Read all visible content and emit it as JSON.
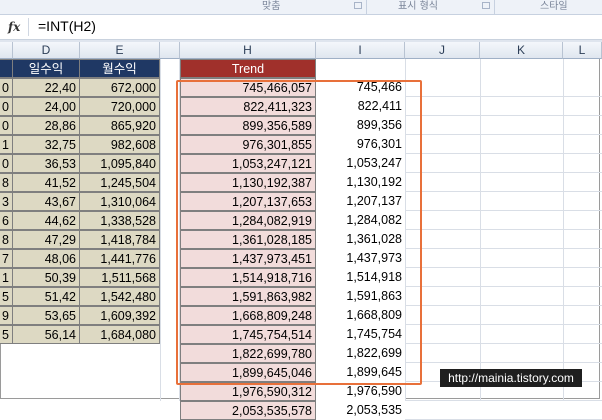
{
  "ribbon": {
    "groups": [
      "맞춤",
      "표시 형식",
      "스타일"
    ]
  },
  "formula_bar": {
    "fx_label": "fx",
    "formula": "=INT(H2)"
  },
  "columns": [
    "",
    "D",
    "E",
    "",
    "H",
    "I",
    "J",
    "K",
    "L"
  ],
  "table": {
    "headers": [
      "",
      "일수익",
      "월수익",
      "Trend"
    ],
    "rows": [
      {
        "c": "0",
        "d": "22,40",
        "e": "672,000",
        "h": "745,466,057",
        "i": "745,466"
      },
      {
        "c": "0",
        "d": "24,00",
        "e": "720,000",
        "h": "822,411,323",
        "i": "822,411"
      },
      {
        "c": "0",
        "d": "28,86",
        "e": "865,920",
        "h": "899,356,589",
        "i": "899,356"
      },
      {
        "c": "1",
        "d": "32,75",
        "e": "982,608",
        "h": "976,301,855",
        "i": "976,301"
      },
      {
        "c": "0",
        "d": "36,53",
        "e": "1,095,840",
        "h": "1,053,247,121",
        "i": "1,053,247"
      },
      {
        "c": "8",
        "d": "41,52",
        "e": "1,245,504",
        "h": "1,130,192,387",
        "i": "1,130,192"
      },
      {
        "c": "3",
        "d": "43,67",
        "e": "1,310,064",
        "h": "1,207,137,653",
        "i": "1,207,137"
      },
      {
        "c": "6",
        "d": "44,62",
        "e": "1,338,528",
        "h": "1,284,082,919",
        "i": "1,284,082"
      },
      {
        "c": "8",
        "d": "47,29",
        "e": "1,418,784",
        "h": "1,361,028,185",
        "i": "1,361,028"
      },
      {
        "c": "7",
        "d": "48,06",
        "e": "1,441,776",
        "h": "1,437,973,451",
        "i": "1,437,973"
      },
      {
        "c": "1",
        "d": "50,39",
        "e": "1,511,568",
        "h": "1,514,918,716",
        "i": "1,514,918"
      },
      {
        "c": "5",
        "d": "51,42",
        "e": "1,542,480",
        "h": "1,591,863,982",
        "i": "1,591,863"
      },
      {
        "c": "9",
        "d": "53,65",
        "e": "1,609,392",
        "h": "1,668,809,248",
        "i": "1,668,809"
      },
      {
        "c": "5",
        "d": "56,14",
        "e": "1,684,080",
        "h": "1,745,754,514",
        "i": "1,745,754"
      },
      {
        "c": "",
        "d": "",
        "e": "",
        "h": "1,822,699,780",
        "i": "1,822,699"
      },
      {
        "c": "",
        "d": "",
        "e": "",
        "h": "1,899,645,046",
        "i": "1,899,645"
      },
      {
        "c": "",
        "d": "",
        "e": "",
        "h": "1,976,590,312",
        "i": "1,976,590"
      },
      {
        "c": "",
        "d": "",
        "e": "",
        "h": "2,053,535,578",
        "i": "2,053,535"
      }
    ]
  },
  "watermark": "http://mainia.tistory.com",
  "colors": {
    "header_navy": "#1f3864",
    "header_red": "#a0302b",
    "cell_tan": "#ddd9c3",
    "cell_pink": "#f2dcdb",
    "highlight_box": "#e8703a"
  }
}
